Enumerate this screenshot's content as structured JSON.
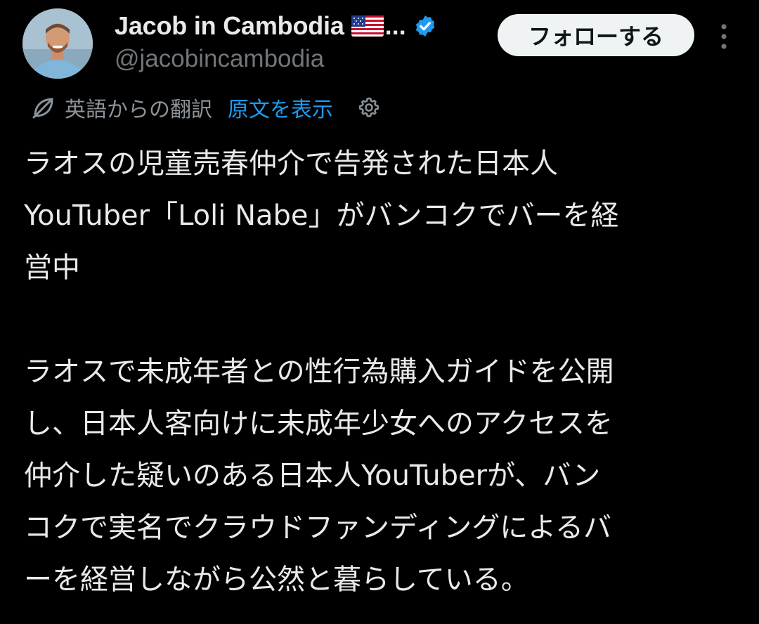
{
  "header": {
    "display_name": "Jacob in Cambodia",
    "flag_icon": "us-flag-icon",
    "ellipsis": "...",
    "verified_icon": "verified-badge-icon",
    "verified_color": "#1d9bf0",
    "handle": "@jacobincambodia",
    "follow_label": "フォローする",
    "more_icon": "more-vertical-icon"
  },
  "translation": {
    "icon": "translate-icon",
    "label": "英語からの翻訳",
    "show_original": "原文を表示",
    "settings_icon": "gear-icon",
    "link_color": "#1d9bf0"
  },
  "tweet": {
    "paragraph_1": "ラオスの児童売春仲介で告発された日本人\nYouTuber「Loli Nabe」がバンコクでバーを経\n営中",
    "paragraph_2": "ラオスで未成年者との性行為購入ガイドを公開\nし、日本人客向けに未成年少女へのアクセスを\n仲介した疑いのある日本人YouTuberが、バン\nコクで実名でクラウドファンディングによるバ\nーを経営しながら公然と暮らしている。"
  },
  "colors": {
    "background": "#000000",
    "text": "#e7e9ea",
    "secondary_text": "#71767b",
    "follow_button_bg": "#eff3f4"
  }
}
